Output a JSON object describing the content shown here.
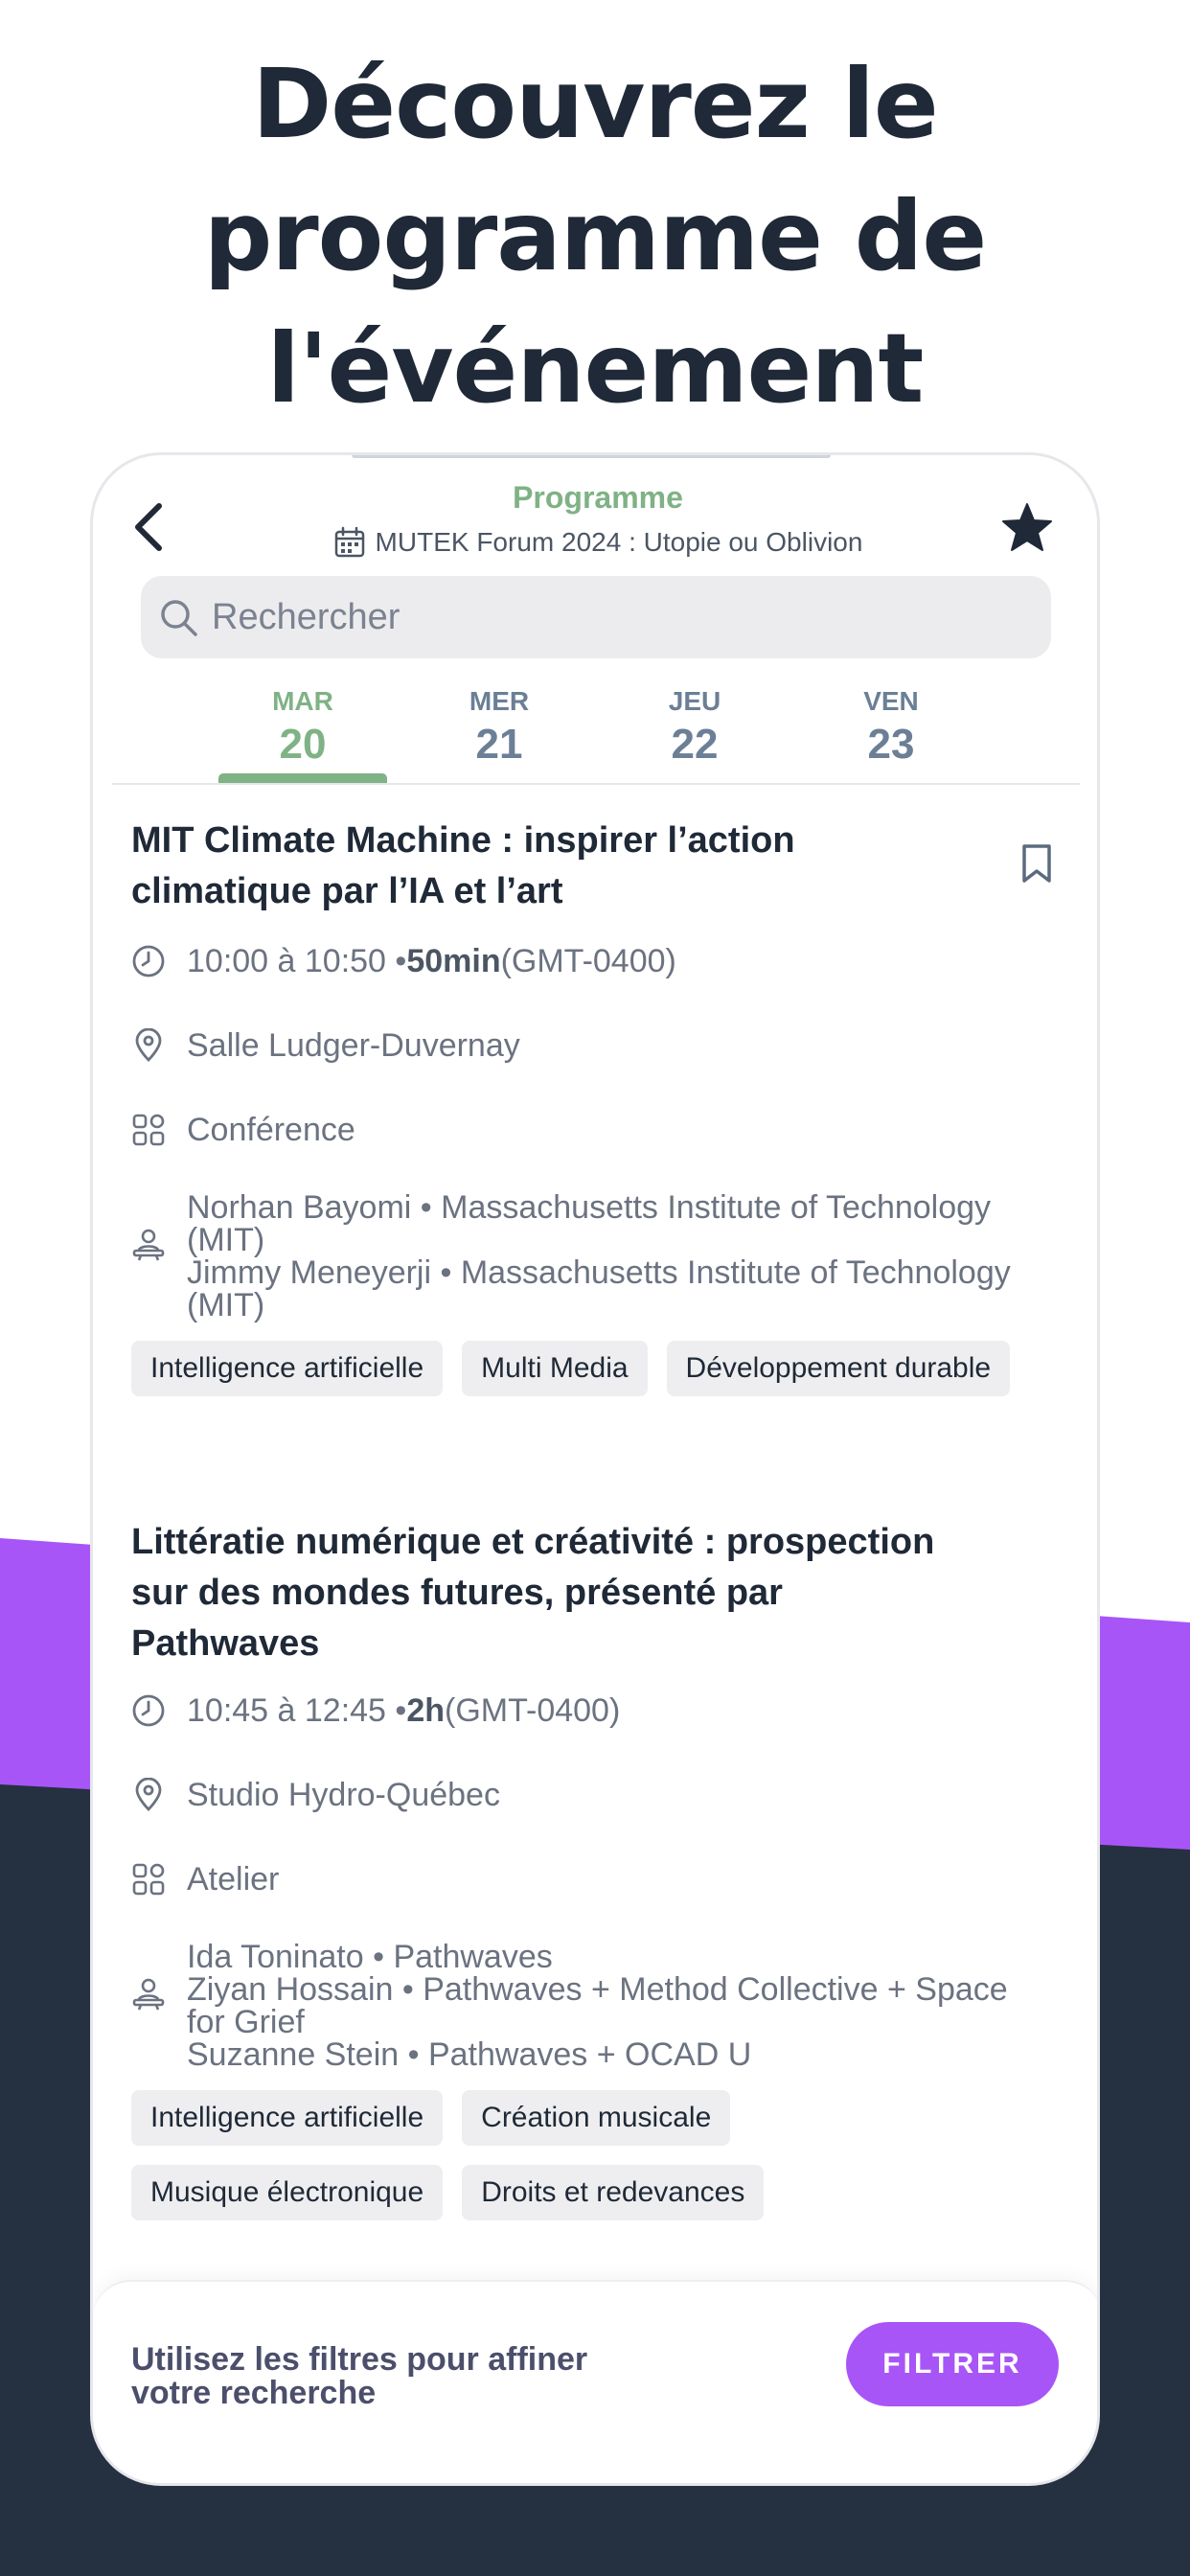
{
  "headline": [
    "Découvrez le",
    "programme de",
    "l'événement"
  ],
  "header": {
    "title": "Programme",
    "subtitle": "MUTEK Forum 2024 : Utopie ou Oblivion"
  },
  "search": {
    "placeholder": "Rechercher"
  },
  "days": [
    {
      "dow": "MAR",
      "num": "20",
      "active": true
    },
    {
      "dow": "MER",
      "num": "21",
      "active": false
    },
    {
      "dow": "JEU",
      "num": "22",
      "active": false
    },
    {
      "dow": "VEN",
      "num": "23",
      "active": false
    }
  ],
  "sessions": [
    {
      "title_lines": [
        "MIT Climate Machine : inspirer l’action",
        "climatique par l’IA et l’art"
      ],
      "time": "10:00 à 10:50 • ",
      "duration": "50min",
      "timezone": " (GMT-0400)",
      "location": "Salle Ludger-Duvernay",
      "type": "Conférence",
      "speakers": [
        "Norhan Bayomi • Massachusetts Institute of Technology",
        "(MIT)",
        "Jimmy Meneyerji • Massachusetts Institute of Technology",
        "(MIT)"
      ],
      "tags": [
        [
          "Intelligence artificielle",
          "Multi Media",
          "Développement durable"
        ]
      ]
    },
    {
      "title_lines": [
        "Littératie numérique et créativité : prospection",
        "sur des mondes futures, présenté par",
        "Pathwaves"
      ],
      "time": "10:45 à 12:45 • ",
      "duration": "2h",
      "timezone": " (GMT-0400)",
      "location": "Studio Hydro-Québec",
      "type": "Atelier",
      "speakers": [
        "Ida Toninato • Pathwaves",
        "Ziyan Hossain • Pathwaves + Method Collective + Space",
        "for Grief",
        "Suzanne Stein • Pathwaves + OCAD U"
      ],
      "tags": [
        [
          "Intelligence artificielle",
          "Création musicale"
        ],
        [
          "Musique électronique",
          "Droits et redevances"
        ]
      ]
    }
  ],
  "filter": {
    "text_lines": [
      "Utilisez les filtres pour affiner",
      "votre recherche"
    ],
    "button": "FILTRER"
  },
  "colors": {
    "accent_green": "#7fb285",
    "accent_purple": "#a855f7",
    "dark_bg": "#253040"
  }
}
